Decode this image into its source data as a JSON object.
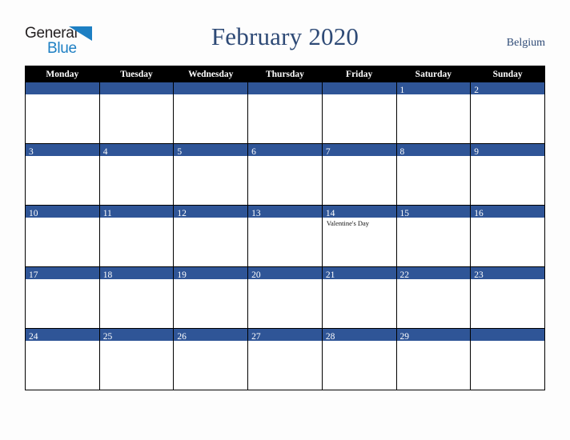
{
  "brand": {
    "word1": "General",
    "word2": "Blue",
    "triangle_color": "#1d7fc3",
    "word1_color": "#231f20",
    "word2_color": "#1d7fc3"
  },
  "header": {
    "title": "February 2020",
    "country": "Belgium",
    "title_color": "#2e4a76"
  },
  "calendar": {
    "accent_color": "#2f5597",
    "header_bg": "#000000",
    "weekdays": [
      "Monday",
      "Tuesday",
      "Wednesday",
      "Thursday",
      "Friday",
      "Saturday",
      "Sunday"
    ],
    "weeks": [
      [
        {
          "day": "",
          "events": []
        },
        {
          "day": "",
          "events": []
        },
        {
          "day": "",
          "events": []
        },
        {
          "day": "",
          "events": []
        },
        {
          "day": "",
          "events": []
        },
        {
          "day": "1",
          "events": []
        },
        {
          "day": "2",
          "events": []
        }
      ],
      [
        {
          "day": "3",
          "events": []
        },
        {
          "day": "4",
          "events": []
        },
        {
          "day": "5",
          "events": []
        },
        {
          "day": "6",
          "events": []
        },
        {
          "day": "7",
          "events": []
        },
        {
          "day": "8",
          "events": []
        },
        {
          "day": "9",
          "events": []
        }
      ],
      [
        {
          "day": "10",
          "events": []
        },
        {
          "day": "11",
          "events": []
        },
        {
          "day": "12",
          "events": []
        },
        {
          "day": "13",
          "events": []
        },
        {
          "day": "14",
          "events": [
            "Valentine's Day"
          ]
        },
        {
          "day": "15",
          "events": []
        },
        {
          "day": "16",
          "events": []
        }
      ],
      [
        {
          "day": "17",
          "events": []
        },
        {
          "day": "18",
          "events": []
        },
        {
          "day": "19",
          "events": []
        },
        {
          "day": "20",
          "events": []
        },
        {
          "day": "21",
          "events": []
        },
        {
          "day": "22",
          "events": []
        },
        {
          "day": "23",
          "events": []
        }
      ],
      [
        {
          "day": "24",
          "events": []
        },
        {
          "day": "25",
          "events": []
        },
        {
          "day": "26",
          "events": []
        },
        {
          "day": "27",
          "events": []
        },
        {
          "day": "28",
          "events": []
        },
        {
          "day": "29",
          "events": []
        },
        {
          "day": "",
          "events": []
        }
      ]
    ]
  }
}
